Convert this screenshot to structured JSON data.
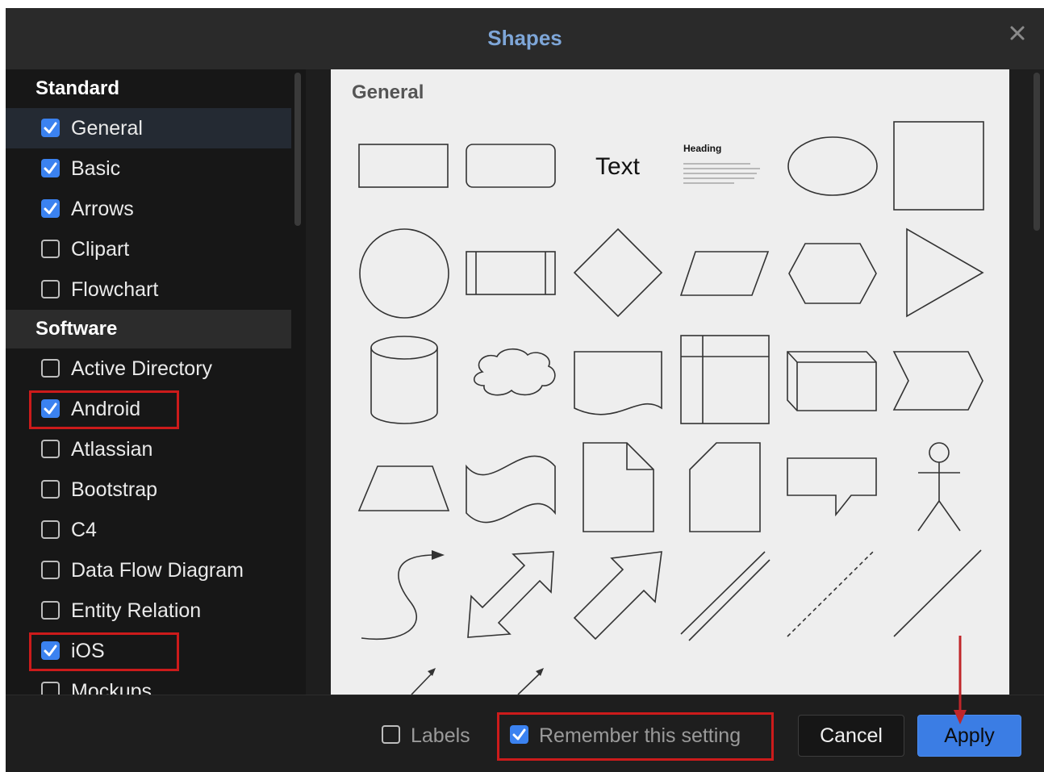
{
  "dialog": {
    "title": "Shapes",
    "close_label": "×"
  },
  "sidebar": {
    "sections": [
      {
        "header": "Standard",
        "items": [
          {
            "label": "General",
            "checked": true,
            "selected": true
          },
          {
            "label": "Basic",
            "checked": true
          },
          {
            "label": "Arrows",
            "checked": true
          },
          {
            "label": "Clipart",
            "checked": false
          },
          {
            "label": "Flowchart",
            "checked": false
          }
        ]
      },
      {
        "header": "Software",
        "items": [
          {
            "label": "Active Directory",
            "checked": false
          },
          {
            "label": "Android",
            "checked": true,
            "highlighted": true
          },
          {
            "label": "Atlassian",
            "checked": false
          },
          {
            "label": "Bootstrap",
            "checked": false
          },
          {
            "label": "C4",
            "checked": false
          },
          {
            "label": "Data Flow Diagram",
            "checked": false
          },
          {
            "label": "Entity Relation",
            "checked": false
          },
          {
            "label": "iOS",
            "checked": true,
            "highlighted": true
          },
          {
            "label": "Mockups",
            "checked": false
          }
        ]
      }
    ]
  },
  "preview": {
    "heading": "General",
    "text_shape_label": "Text",
    "heading_shape_label": "Heading",
    "shape_icons": [
      "rectangle",
      "rounded-rectangle",
      "text",
      "heading-text",
      "ellipse",
      "square",
      "circle",
      "process",
      "diamond",
      "parallelogram",
      "hexagon",
      "triangle",
      "cylinder",
      "cloud",
      "document",
      "internal-storage",
      "cube",
      "step",
      "trapezoid",
      "tape",
      "note",
      "card",
      "callout",
      "actor",
      "curved-arrow",
      "bidirectional-arrow",
      "arrow",
      "double-line",
      "dashed-line",
      "line"
    ]
  },
  "footer": {
    "labels_label": "Labels",
    "labels_checked": false,
    "remember_label": "Remember this setting",
    "remember_checked": true,
    "cancel_label": "Cancel",
    "apply_label": "Apply"
  },
  "colors": {
    "accent": "#3b82f0",
    "highlight": "#cc1b1b",
    "title": "#7ea6d8"
  }
}
